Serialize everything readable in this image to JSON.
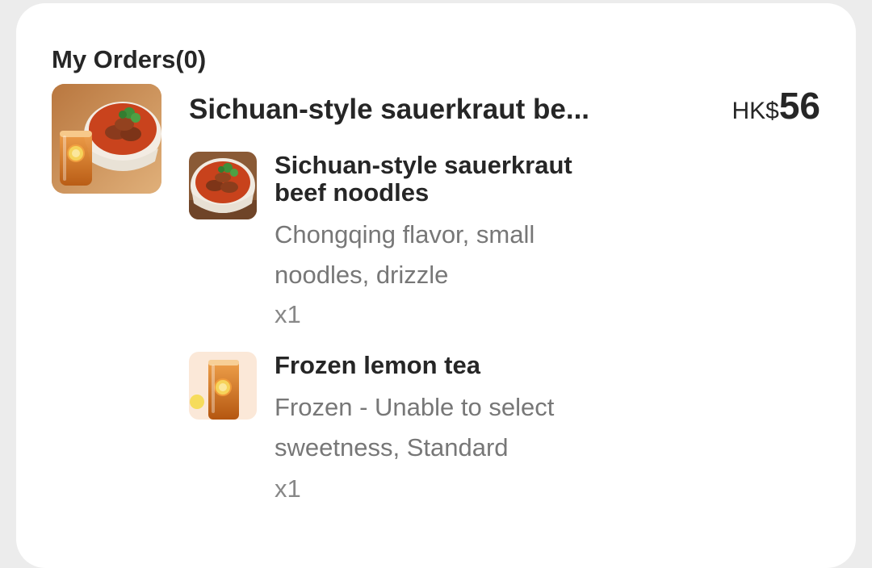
{
  "orders": {
    "title": "My Orders(0)",
    "combo": {
      "name": "Sichuan-style sauerkraut be...",
      "price_currency": "HK$",
      "price_amount": "56",
      "image_icon": "noodle-and-tea-photo"
    },
    "items": [
      {
        "name": "Sichuan-style sauerkraut beef noodles",
        "spec": "Chongqing flavor, small noodles, drizzle",
        "qty": "x1",
        "image_icon": "beef-noodle-bowl-photo"
      },
      {
        "name": "Frozen lemon tea",
        "spec": "Frozen - Unable to select sweetness, Standard",
        "qty": "x1",
        "image_icon": "lemon-tea-glass-photo"
      }
    ]
  }
}
